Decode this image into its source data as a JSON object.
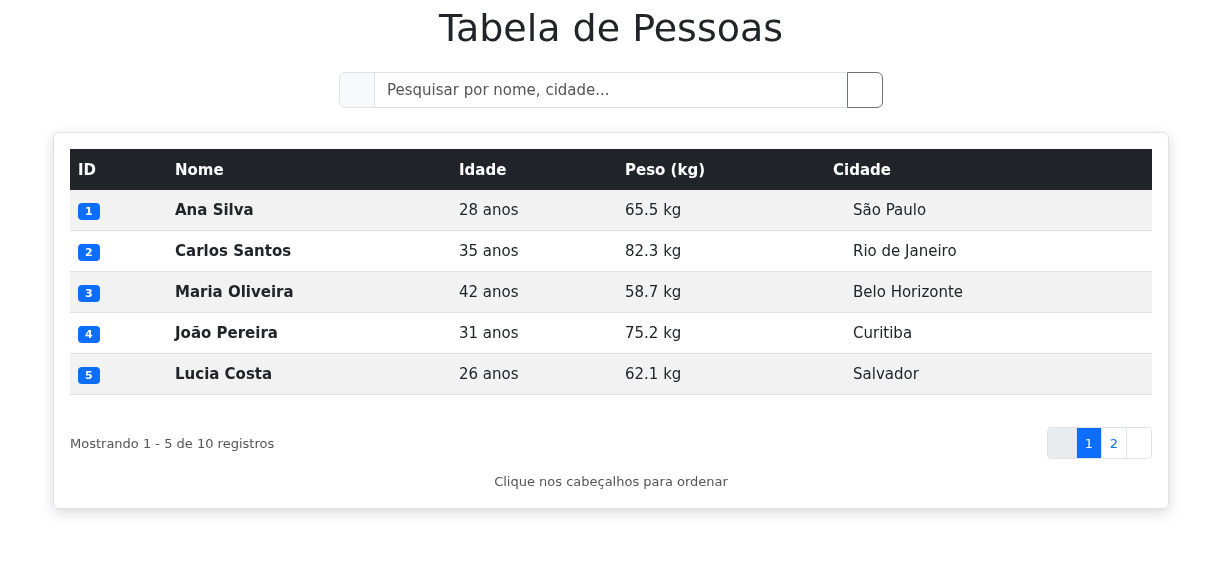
{
  "title": "Tabela de Pessoas",
  "search": {
    "placeholder": "Pesquisar por nome, cidade..."
  },
  "table": {
    "columns": [
      "ID",
      "Nome",
      "Idade",
      "Peso (kg)",
      "Cidade"
    ],
    "rows": [
      {
        "id": "1",
        "name": "Ana Silva",
        "age": "28 anos",
        "weight": "65.5 kg",
        "city": "São Paulo"
      },
      {
        "id": "2",
        "name": "Carlos Santos",
        "age": "35 anos",
        "weight": "82.3 kg",
        "city": "Rio de Janeiro"
      },
      {
        "id": "3",
        "name": "Maria Oliveira",
        "age": "42 anos",
        "weight": "58.7 kg",
        "city": "Belo Horizonte"
      },
      {
        "id": "4",
        "name": "João Pereira",
        "age": "31 anos",
        "weight": "75.2 kg",
        "city": "Curitiba"
      },
      {
        "id": "5",
        "name": "Lucia Costa",
        "age": "26 anos",
        "weight": "62.1 kg",
        "city": "Salvador"
      }
    ]
  },
  "summary": "Mostrando 1 - 5 de 10 registros",
  "pagination": {
    "prev_disabled": true,
    "next_disabled": false,
    "pages": [
      {
        "label": "1",
        "selected": true
      },
      {
        "label": "2",
        "selected": false
      }
    ]
  },
  "hint": "Clique nos cabeçalhos para ordenar"
}
